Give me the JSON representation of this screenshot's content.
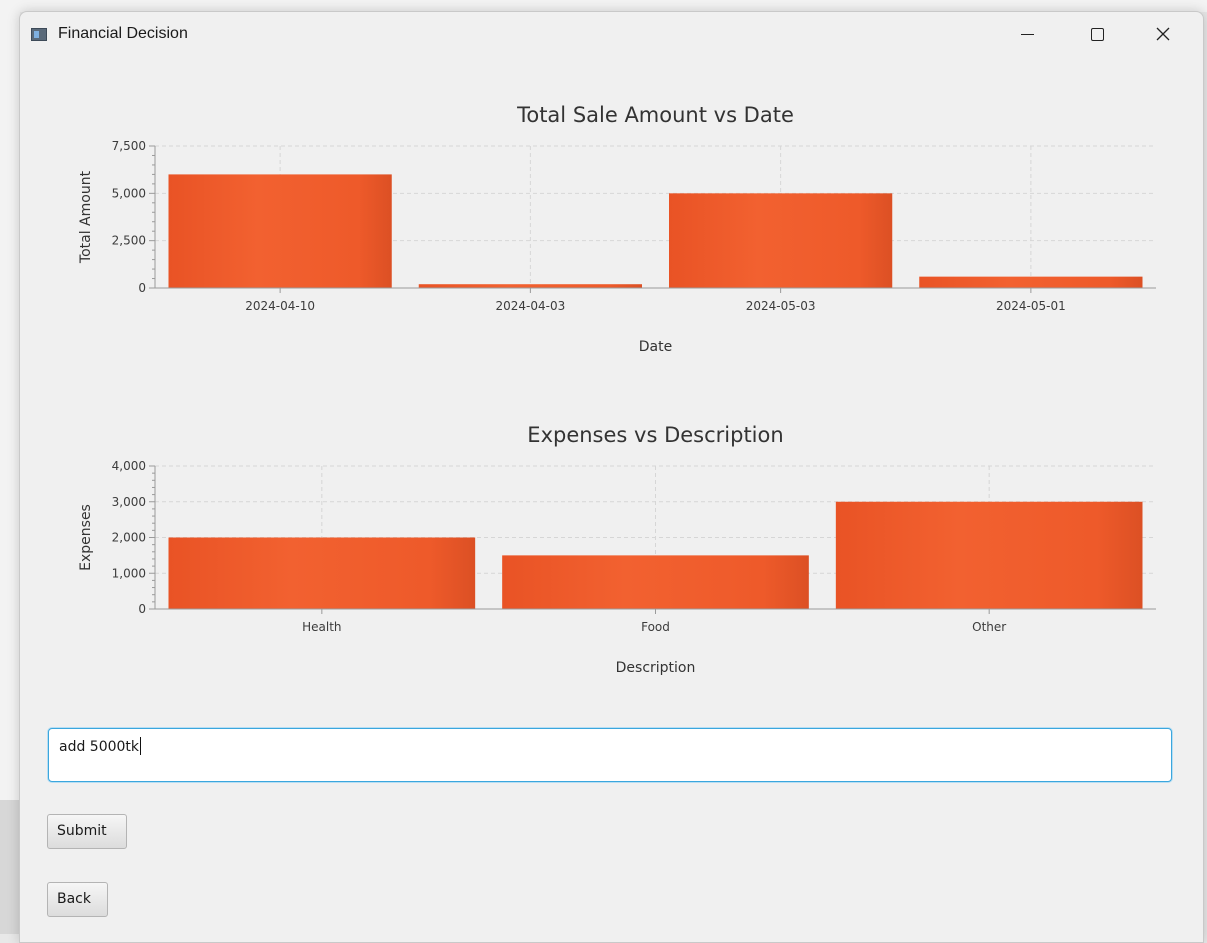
{
  "window": {
    "title": "Financial Decision"
  },
  "charts": {
    "sales": {
      "chart_data": {
        "type": "bar",
        "title": "Total Sale Amount vs Date",
        "xlabel": "Date",
        "ylabel": "Total Amount",
        "categories": [
          "2024-04-10",
          "2024-04-03",
          "2024-05-03",
          "2024-05-01"
        ],
        "values": [
          6000,
          200,
          5000,
          600
        ],
        "ylim": [
          0,
          7500
        ],
        "yticks": [
          0,
          2500,
          5000,
          7500
        ],
        "ytick_labels": [
          "0",
          "2,500",
          "5,000",
          "7,500"
        ],
        "grid": true,
        "color": "#f0592a"
      }
    },
    "expenses": {
      "chart_data": {
        "type": "bar",
        "title": "Expenses vs Description",
        "xlabel": "Description",
        "ylabel": "Expenses",
        "categories": [
          "Health",
          "Food",
          "Other"
        ],
        "values": [
          2000,
          1500,
          3000
        ],
        "ylim": [
          0,
          4000
        ],
        "yticks": [
          0,
          1000,
          2000,
          3000,
          4000
        ],
        "ytick_labels": [
          "0",
          "1,000",
          "2,000",
          "3,000",
          "4,000"
        ],
        "grid": true,
        "color": "#f0592a"
      }
    }
  },
  "form": {
    "input_value": "add 5000tk",
    "submit_label": "Submit",
    "back_label": "Back"
  }
}
